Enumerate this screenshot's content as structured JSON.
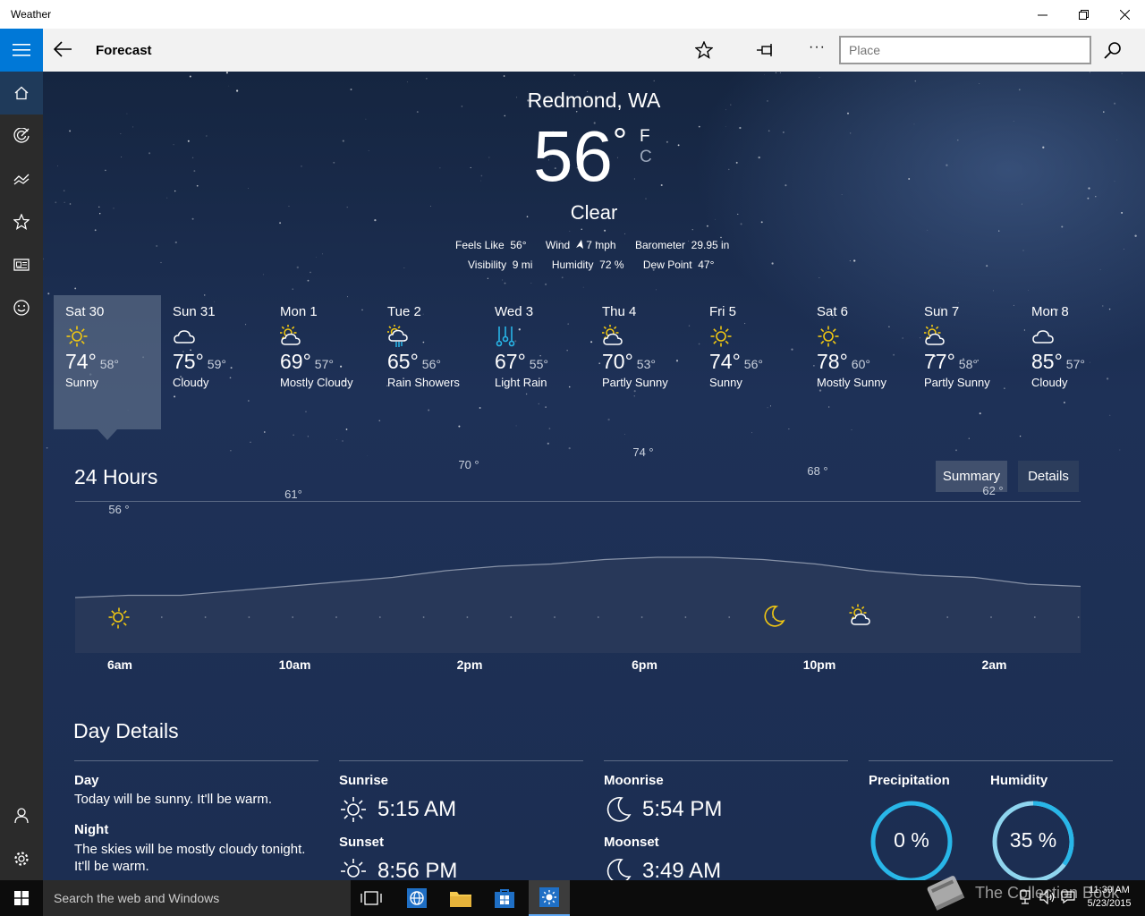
{
  "window": {
    "title": "Weather"
  },
  "command_bar": {
    "page_title": "Forecast",
    "search_placeholder": "Place"
  },
  "current": {
    "location": "Redmond, WA",
    "temp": "56",
    "unit_deg": "°",
    "unit_f": "F",
    "unit_c": "C",
    "condition": "Clear",
    "details": [
      {
        "label": "Feels Like",
        "value": "56°"
      },
      {
        "label": "Wind",
        "value": "7 mph"
      },
      {
        "label": "Barometer",
        "value": "29.95 in"
      },
      {
        "label": "Visibility",
        "value": "9 mi"
      },
      {
        "label": "Humidity",
        "value": "72 %"
      },
      {
        "label": "Dew Point",
        "value": "47°"
      }
    ]
  },
  "forecast": [
    {
      "day": "Sat 30",
      "hi": "74°",
      "lo": "58°",
      "cond": "Sunny",
      "icon": "sun-icon"
    },
    {
      "day": "Sun 31",
      "hi": "75°",
      "lo": "59°",
      "cond": "Cloudy",
      "icon": "cloud-icon"
    },
    {
      "day": "Mon 1",
      "hi": "69°",
      "lo": "57°",
      "cond": "Mostly Cloudy",
      "icon": "partly-cloudy-icon"
    },
    {
      "day": "Tue 2",
      "hi": "65°",
      "lo": "56°",
      "cond": "Rain Showers",
      "icon": "rain-showers-icon"
    },
    {
      "day": "Wed 3",
      "hi": "67°",
      "lo": "55°",
      "cond": "Light Rain",
      "icon": "light-rain-icon"
    },
    {
      "day": "Thu 4",
      "hi": "70°",
      "lo": "53°",
      "cond": "Partly Sunny",
      "icon": "partly-sunny-icon"
    },
    {
      "day": "Fri 5",
      "hi": "74°",
      "lo": "56°",
      "cond": "Sunny",
      "icon": "sun-icon"
    },
    {
      "day": "Sat 6",
      "hi": "78°",
      "lo": "60°",
      "cond": "Mostly Sunny",
      "icon": "sun-icon"
    },
    {
      "day": "Sun 7",
      "hi": "77°",
      "lo": "58°",
      "cond": "Partly Sunny",
      "icon": "partly-sunny-icon"
    },
    {
      "day": "Mon 8",
      "hi": "85°",
      "lo": "57°",
      "cond": "Cloudy",
      "icon": "cloud-icon"
    }
  ],
  "hourly": {
    "title": "24 Hours",
    "summary_label": "Summary",
    "details_label": "Details",
    "hour_labels": [
      "6am",
      "10am",
      "2pm",
      "6pm",
      "10pm",
      "2am"
    ],
    "temp_labels": [
      "56 °",
      "61°",
      "70 °",
      "74 °",
      "68 °",
      "62 °"
    ],
    "temps": [
      56,
      57,
      57,
      59,
      61,
      63,
      65,
      68,
      70,
      71,
      73,
      74,
      74,
      73,
      71,
      68,
      66,
      65,
      62,
      61
    ]
  },
  "day_details": {
    "title": "Day Details",
    "day_label": "Day",
    "day_text": "Today will be sunny. It'll be warm.",
    "night_label": "Night",
    "night_text": "The skies will be mostly cloudy tonight. It'll be warm.",
    "sunrise_label": "Sunrise",
    "sunrise": "5:15 AM",
    "sunset_label": "Sunset",
    "sunset": "8:56 PM",
    "moonrise_label": "Moonrise",
    "moonrise": "5:54 PM",
    "moonset_label": "Moonset",
    "moonset": "3:49 AM",
    "precip_label": "Precipitation",
    "precip": "0 %",
    "precip_value": 0,
    "humidity_label": "Humidity",
    "humidity": "35 %",
    "humidity_value": 35
  },
  "taskbar": {
    "search_placeholder": "Search the web and Windows",
    "time": "11:39 AM",
    "date": "5/23/2015",
    "watermark": "The Collection Book"
  },
  "colors": {
    "accent": "#0078d7",
    "sun": "#f2c811",
    "ring": "#28b6e8"
  }
}
